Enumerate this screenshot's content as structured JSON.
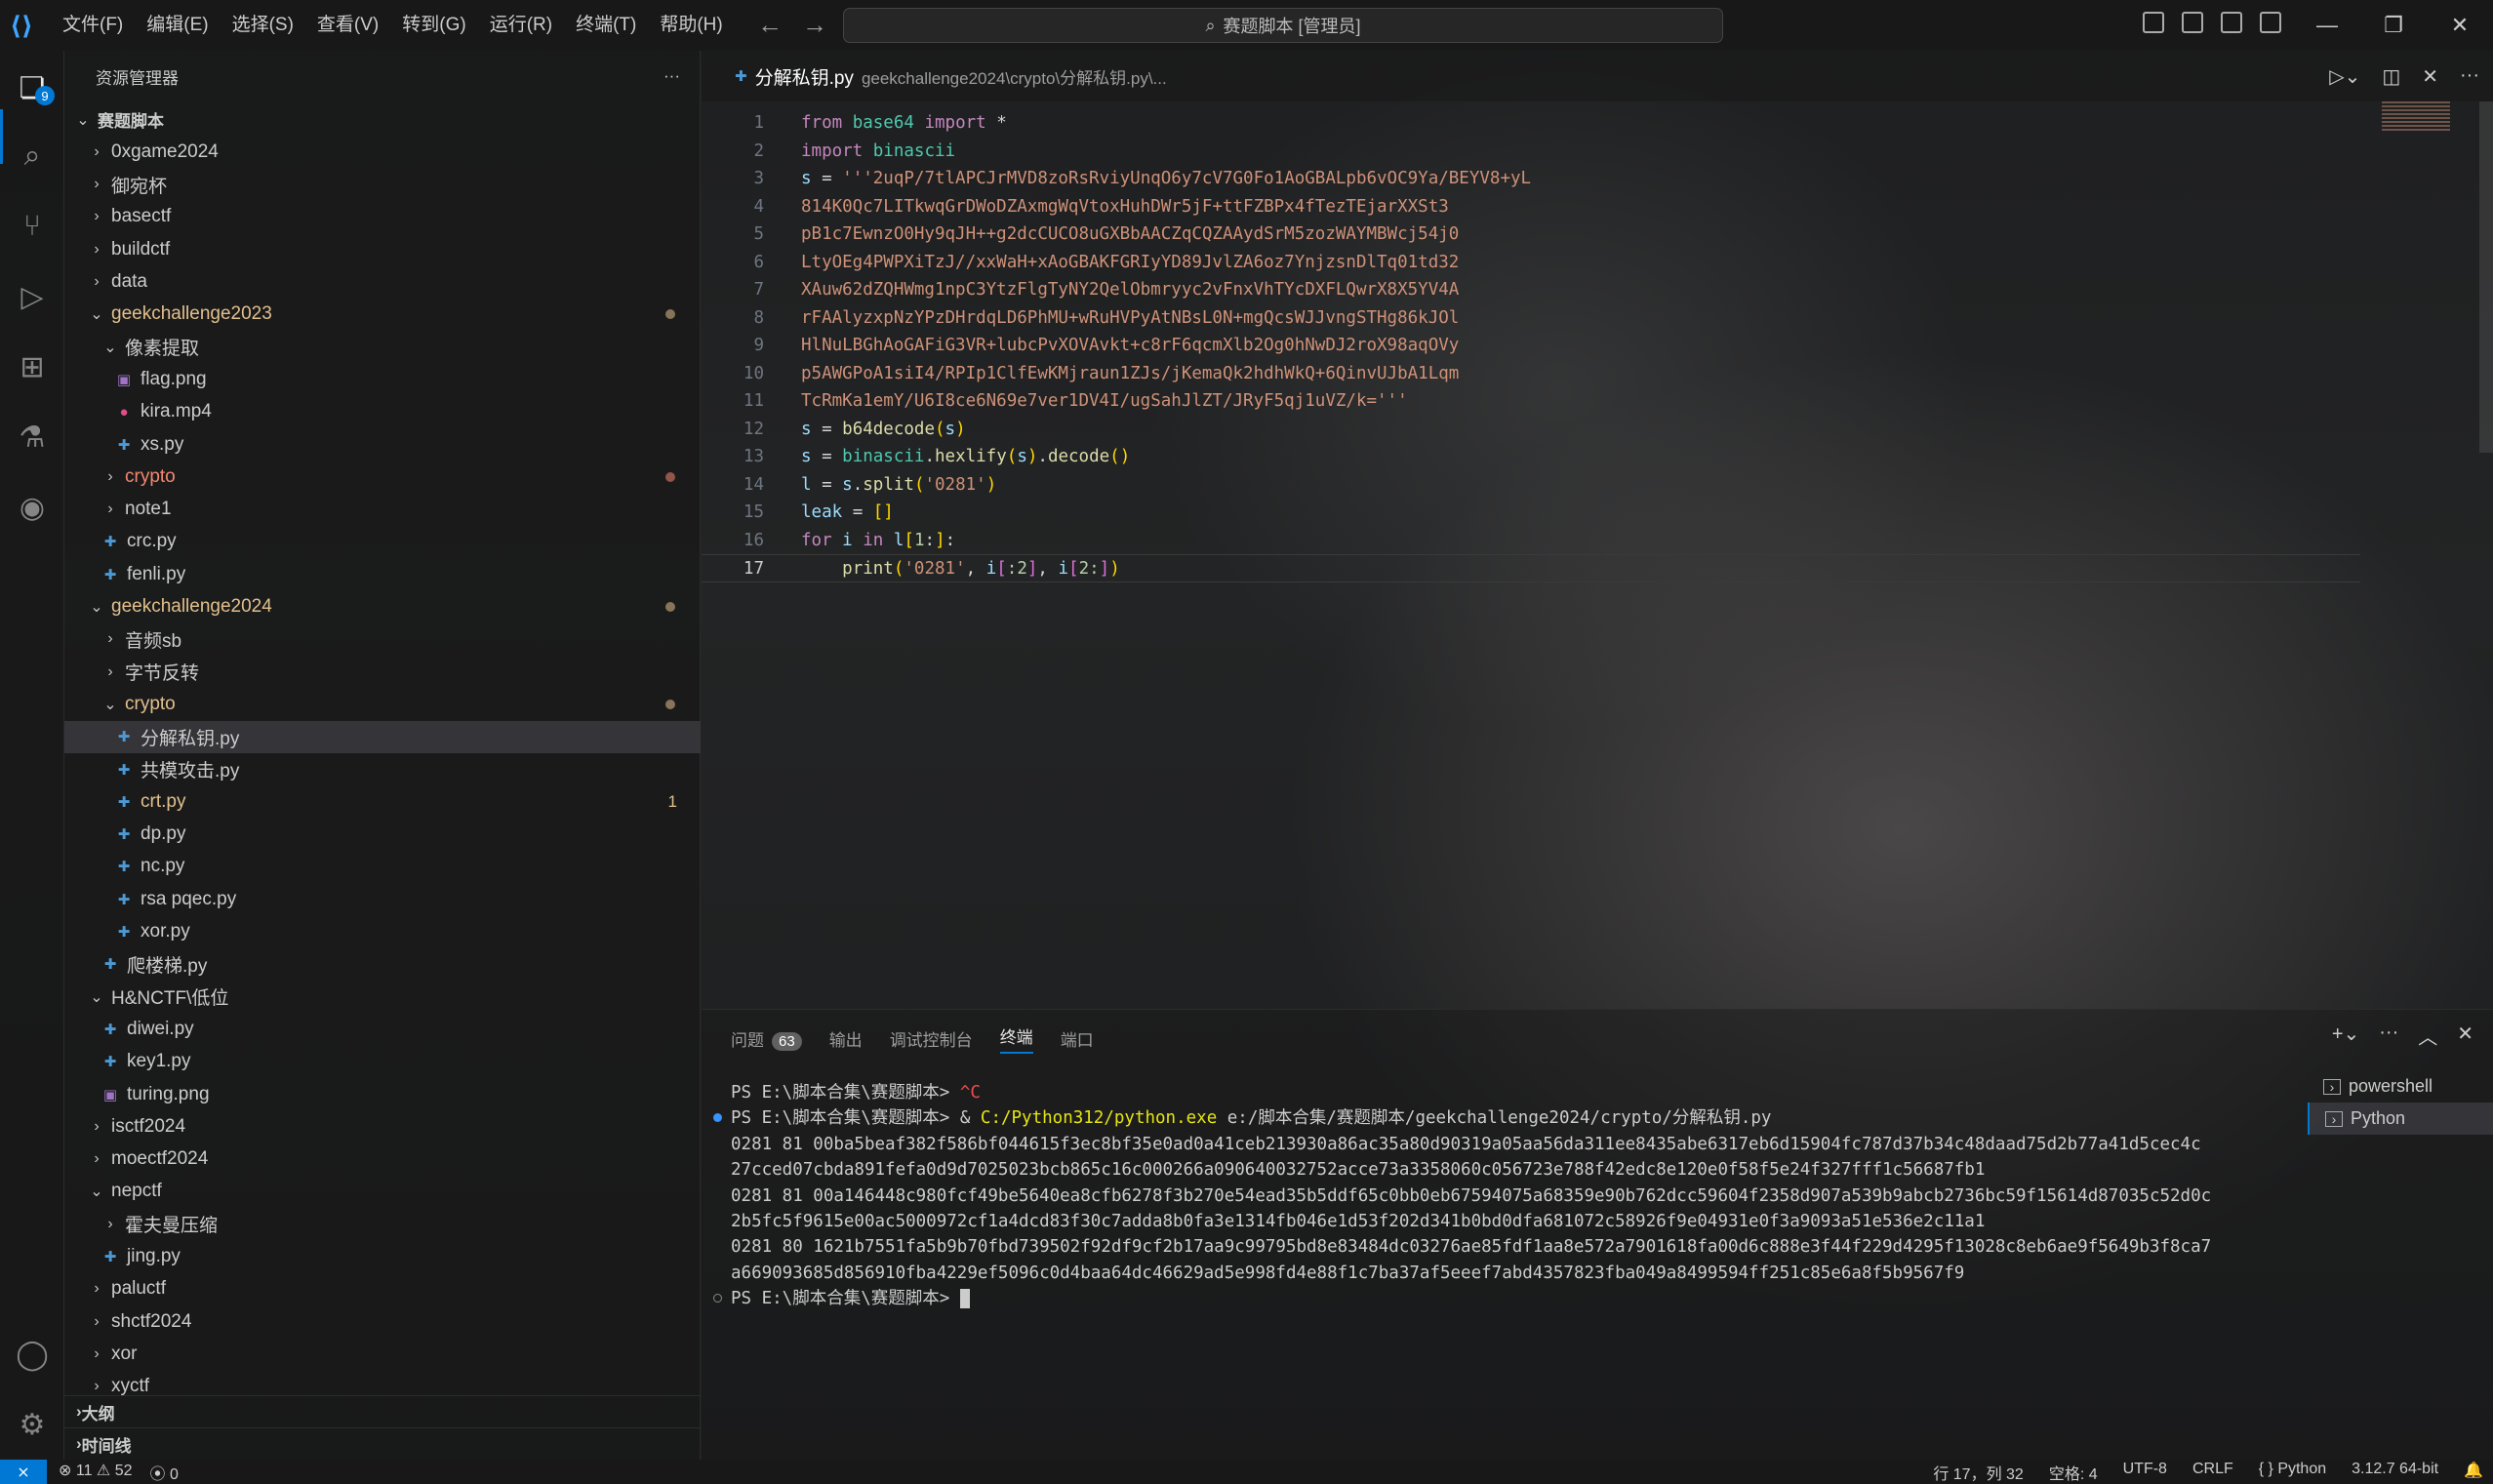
{
  "app": {
    "title": "赛题脚本 [管理员]"
  },
  "menu": [
    "文件(F)",
    "编辑(E)",
    "选择(S)",
    "查看(V)",
    "转到(G)",
    "运行(R)",
    "终端(T)",
    "帮助(H)"
  ],
  "activity": {
    "explorer_badge": "9"
  },
  "sidebar": {
    "title": "资源管理器",
    "more": "···",
    "root": "赛题脚本",
    "items": [
      {
        "label": "0xgame2024",
        "type": "folder",
        "open": false,
        "indent": 1
      },
      {
        "label": "御宛杯",
        "type": "folder",
        "open": false,
        "indent": 1
      },
      {
        "label": "basectf",
        "type": "folder",
        "open": false,
        "indent": 1
      },
      {
        "label": "buildctf",
        "type": "folder",
        "open": false,
        "indent": 1
      },
      {
        "label": "data",
        "type": "folder",
        "open": false,
        "indent": 1
      },
      {
        "label": "geekchallenge2023",
        "type": "folder",
        "open": true,
        "indent": 1,
        "modified": true
      },
      {
        "label": "像素提取",
        "type": "folder",
        "open": true,
        "indent": 2
      },
      {
        "label": "flag.png",
        "type": "image",
        "indent": 3
      },
      {
        "label": "kira.mp4",
        "type": "video",
        "indent": 3
      },
      {
        "label": "xs.py",
        "type": "py",
        "indent": 3
      },
      {
        "label": "crypto",
        "type": "folder",
        "open": false,
        "indent": 2,
        "error": true
      },
      {
        "label": "note1",
        "type": "folder",
        "open": false,
        "indent": 2
      },
      {
        "label": "crc.py",
        "type": "py",
        "indent": 2
      },
      {
        "label": "fenli.py",
        "type": "py",
        "indent": 2
      },
      {
        "label": "geekchallenge2024",
        "type": "folder",
        "open": true,
        "indent": 1,
        "modified": true
      },
      {
        "label": "音频sb",
        "type": "folder",
        "open": false,
        "indent": 2
      },
      {
        "label": "字节反转",
        "type": "folder",
        "open": false,
        "indent": 2
      },
      {
        "label": "crypto",
        "type": "folder",
        "open": true,
        "indent": 2,
        "modified": true
      },
      {
        "label": "分解私钥.py",
        "type": "py",
        "indent": 3,
        "selected": true
      },
      {
        "label": "共模攻击.py",
        "type": "py",
        "indent": 3
      },
      {
        "label": "crt.py",
        "type": "py",
        "indent": 3,
        "git": true,
        "count": "1"
      },
      {
        "label": "dp.py",
        "type": "py",
        "indent": 3
      },
      {
        "label": "nc.py",
        "type": "py",
        "indent": 3
      },
      {
        "label": "rsa pqec.py",
        "type": "py",
        "indent": 3
      },
      {
        "label": "xor.py",
        "type": "py",
        "indent": 3
      },
      {
        "label": "爬楼梯.py",
        "type": "py",
        "indent": 2
      },
      {
        "label": "H&NCTF\\低位",
        "type": "folder",
        "open": true,
        "indent": 1
      },
      {
        "label": "diwei.py",
        "type": "py",
        "indent": 2
      },
      {
        "label": "key1.py",
        "type": "py",
        "indent": 2
      },
      {
        "label": "turing.png",
        "type": "image",
        "indent": 2
      },
      {
        "label": "isctf2024",
        "type": "folder",
        "open": false,
        "indent": 1
      },
      {
        "label": "moectf2024",
        "type": "folder",
        "open": false,
        "indent": 1
      },
      {
        "label": "nepctf",
        "type": "folder",
        "open": true,
        "indent": 1
      },
      {
        "label": "霍夫曼压缩",
        "type": "folder",
        "open": false,
        "indent": 2
      },
      {
        "label": "jing.py",
        "type": "py",
        "indent": 2
      },
      {
        "label": "paluctf",
        "type": "folder",
        "open": false,
        "indent": 1
      },
      {
        "label": "shctf2024",
        "type": "folder",
        "open": false,
        "indent": 1
      },
      {
        "label": "xor",
        "type": "folder",
        "open": false,
        "indent": 1
      },
      {
        "label": "xyctf",
        "type": "folder",
        "open": false,
        "indent": 1
      }
    ],
    "outline": "大纲",
    "timeline": "时间线"
  },
  "editor": {
    "tab_name": "分解私钥.py",
    "tab_path": "geekchallenge2024\\crypto\\分解私钥.py\\...",
    "current_line": 17,
    "lines": [
      [
        {
          "t": "from",
          "c": "kw"
        },
        {
          "t": " ",
          "c": "op"
        },
        {
          "t": "base64",
          "c": "mod"
        },
        {
          "t": " ",
          "c": "op"
        },
        {
          "t": "import",
          "c": "kw"
        },
        {
          "t": " *",
          "c": "op"
        }
      ],
      [
        {
          "t": "import",
          "c": "kw"
        },
        {
          "t": " ",
          "c": "op"
        },
        {
          "t": "binascii",
          "c": "mod"
        }
      ],
      [
        {
          "t": "s",
          "c": "id"
        },
        {
          "t": " = ",
          "c": "op"
        },
        {
          "t": "'''2uqP/7tlAPCJrMVD8zoRsRviyUnqO6y7cV7G0Fo1AoGBALpb6vOC9Ya/BEYV8+yL",
          "c": "str"
        }
      ],
      [
        {
          "t": "814K0Qc7LITkwqGrDWoDZAxmgWqVtoxHuhDWr5jF+ttFZBPx4fTezTEjarXXSt3",
          "c": "str"
        }
      ],
      [
        {
          "t": "pB1c7EwnzO0Hy9qJH++g2dcCUCO8uGXBbAACZqCQZAAydSrM5zozWAYMBWcj54j0",
          "c": "str"
        }
      ],
      [
        {
          "t": "LtyOEg4PWPXiTzJ//xxWaH+xAoGBAKFGRIyYD89JvlZA6oz7YnjzsnDlTq01td32",
          "c": "str"
        }
      ],
      [
        {
          "t": "XAuw62dZQHWmg1npC3YtzFlgTyNY2QelObmryyc2vFnxVhTYcDXFLQwrX8X5YV4A",
          "c": "str"
        }
      ],
      [
        {
          "t": "rFAAlyzxpNzYPzDHrdqLD6PhMU+wRuHVPyAtNBsL0N+mgQcsWJJvngSTHg86kJOl",
          "c": "str"
        }
      ],
      [
        {
          "t": "HlNuLBGhAoGAFiG3VR+lubcPvXOVAvkt+c8rF6qcmXlb2Og0hNwDJ2roX98aqOVy",
          "c": "str"
        }
      ],
      [
        {
          "t": "p5AWGPoA1siI4/RPIp1ClfEwKMjraun1ZJs/jKemaQk2hdhWkQ+6QinvUJbA1Lqm",
          "c": "str"
        }
      ],
      [
        {
          "t": "TcRmKa1emY/U6I8ce6N69e7ver1DV4I/ugSahJlZT/JRyF5qj1uVZ/k='''",
          "c": "str"
        }
      ],
      [
        {
          "t": "s",
          "c": "id"
        },
        {
          "t": " = ",
          "c": "op"
        },
        {
          "t": "b64decode",
          "c": "fn"
        },
        {
          "t": "(",
          "c": "br1"
        },
        {
          "t": "s",
          "c": "id"
        },
        {
          "t": ")",
          "c": "br1"
        }
      ],
      [
        {
          "t": "s",
          "c": "id"
        },
        {
          "t": " = ",
          "c": "op"
        },
        {
          "t": "binascii",
          "c": "mod"
        },
        {
          "t": ".",
          "c": "op"
        },
        {
          "t": "hexlify",
          "c": "fn"
        },
        {
          "t": "(",
          "c": "br1"
        },
        {
          "t": "s",
          "c": "id"
        },
        {
          "t": ")",
          "c": "br1"
        },
        {
          "t": ".",
          "c": "op"
        },
        {
          "t": "decode",
          "c": "fn"
        },
        {
          "t": "()",
          "c": "br1"
        }
      ],
      [
        {
          "t": "l",
          "c": "id"
        },
        {
          "t": " = ",
          "c": "op"
        },
        {
          "t": "s",
          "c": "id"
        },
        {
          "t": ".",
          "c": "op"
        },
        {
          "t": "split",
          "c": "fn"
        },
        {
          "t": "(",
          "c": "br1"
        },
        {
          "t": "'0281'",
          "c": "str"
        },
        {
          "t": ")",
          "c": "br1"
        }
      ],
      [
        {
          "t": "leak",
          "c": "id"
        },
        {
          "t": " = ",
          "c": "op"
        },
        {
          "t": "[]",
          "c": "br1"
        }
      ],
      [
        {
          "t": "for",
          "c": "kw"
        },
        {
          "t": " ",
          "c": "op"
        },
        {
          "t": "i",
          "c": "id"
        },
        {
          "t": " ",
          "c": "op"
        },
        {
          "t": "in",
          "c": "kw"
        },
        {
          "t": " ",
          "c": "op"
        },
        {
          "t": "l",
          "c": "id"
        },
        {
          "t": "[",
          "c": "br1"
        },
        {
          "t": "1",
          "c": "num"
        },
        {
          "t": ":",
          "c": "op"
        },
        {
          "t": "]",
          "c": "br1"
        },
        {
          "t": ":",
          "c": "op"
        }
      ],
      [
        {
          "t": "    ",
          "c": "op"
        },
        {
          "t": "print",
          "c": "fn"
        },
        {
          "t": "(",
          "c": "br1"
        },
        {
          "t": "'0281'",
          "c": "str"
        },
        {
          "t": ", ",
          "c": "op"
        },
        {
          "t": "i",
          "c": "id"
        },
        {
          "t": "[",
          "c": "br2"
        },
        {
          "t": ":2",
          "c": "num"
        },
        {
          "t": "]",
          "c": "br2"
        },
        {
          "t": ", ",
          "c": "op"
        },
        {
          "t": "i",
          "c": "id"
        },
        {
          "t": "[",
          "c": "br2"
        },
        {
          "t": "2:",
          "c": "num"
        },
        {
          "t": "]",
          "c": "br2"
        },
        {
          "t": ")",
          "c": "br1"
        }
      ]
    ]
  },
  "panel": {
    "tabs": [
      "问题",
      "输出",
      "调试控制台",
      "终端",
      "端口"
    ],
    "problems_count": "63",
    "active_tab": "终端",
    "terminal_lines": [
      {
        "parts": [
          {
            "t": "PS E:\\脚本合集\\赛题脚本> ",
            "c": "ps"
          },
          {
            "t": "^C",
            "c": "ctrlc"
          }
        ],
        "dot": ""
      },
      {
        "parts": [
          {
            "t": "PS E:\\脚本合集\\赛题脚本> ",
            "c": "ps"
          },
          {
            "t": "& ",
            "c": "path-cmd"
          },
          {
            "t": "C:/Python312/python.exe",
            "c": "cmd-yellow"
          },
          {
            "t": " e:/脚本合集/赛题脚本/geekchallenge2024/crypto/分解私钥.py",
            "c": "path-cmd"
          }
        ],
        "dot": "blue"
      },
      {
        "parts": [
          {
            "t": "0281 81 00ba5beaf382f586bf044615f3ec8bf35e0ad0a41ceb213930a86ac35a80d90319a05aa56da311ee8435abe6317eb6d15904fc787d37b34c48daad75d2b77a41d5cec4c",
            "c": "ps"
          }
        ],
        "dot": ""
      },
      {
        "parts": [
          {
            "t": "27cced07cbda891fefa0d9d7025023bcb865c16c000266a090640032752acce73a3358060c056723e788f42edc8e120e0f58f5e24f327fff1c56687fb1",
            "c": "ps"
          }
        ],
        "dot": ""
      },
      {
        "parts": [
          {
            "t": "0281 81 00a146448c980fcf49be5640ea8cfb6278f3b270e54ead35b5ddf65c0bb0eb67594075a68359e90b762dcc59604f2358d907a539b9abcb2736bc59f15614d87035c52d0c",
            "c": "ps"
          }
        ],
        "dot": ""
      },
      {
        "parts": [
          {
            "t": "2b5fc5f9615e00ac5000972cf1a4dcd83f30c7adda8b0fa3e1314fb046e1d53f202d341b0bd0dfa681072c58926f9e04931e0f3a9093a51e536e2c11a1",
            "c": "ps"
          }
        ],
        "dot": ""
      },
      {
        "parts": [
          {
            "t": "0281 80 1621b7551fa5b9b70fbd739502f92df9cf2b17aa9c99795bd8e83484dc03276ae85fdf1aa8e572a7901618fa00d6c888e3f44f229d4295f13028c8eb6ae9f5649b3f8ca7",
            "c": "ps"
          }
        ],
        "dot": ""
      },
      {
        "parts": [
          {
            "t": "a669093685d856910fba4229ef5096c0d4baa64dc46629ad5e998fd4e88f1c7ba37af5eeef7abd4357823fba049a8499594ff251c85e6a8f5b9567f9",
            "c": "ps"
          }
        ],
        "dot": ""
      },
      {
        "parts": [
          {
            "t": "PS E:\\脚本合集\\赛题脚本> ",
            "c": "ps"
          }
        ],
        "dot": "hollow",
        "cursor": true
      }
    ],
    "terminals": [
      "powershell",
      "Python"
    ]
  },
  "status": {
    "errors": "11",
    "warnings": "52",
    "ports": "0",
    "position": "行 17，列 32",
    "spaces": "空格: 4",
    "encoding": "UTF-8",
    "eol": "CRLF",
    "language": "Python",
    "interpreter": "3.12.7 64-bit"
  }
}
